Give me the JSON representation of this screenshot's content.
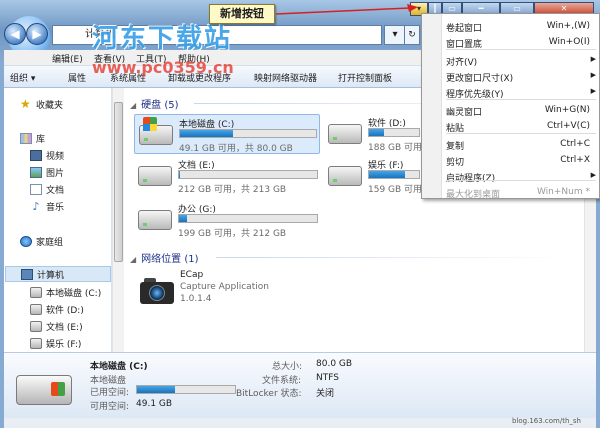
{
  "address": {
    "path": "计算机",
    "arrow": "▾",
    "refresh": "↻"
  },
  "nav_buttons": {
    "back": "◀",
    "forward": "▶"
  },
  "menubar": [
    "编辑(E)",
    "查看(V)",
    "工具(T)",
    "帮助(H)"
  ],
  "toolbar": [
    "组织 ▾",
    "属性",
    "系统属性",
    "卸载或更改程序",
    "映射网络驱动器",
    "打开控制面板"
  ],
  "nav": {
    "favorites": "收藏夹",
    "libraries": "库",
    "lib_items": [
      "视频",
      "图片",
      "文档",
      "音乐"
    ],
    "homegroup": "家庭组",
    "computer": "计算机",
    "drives": [
      "本地磁盘 (C:)",
      "软件 (D:)",
      "文档 (E:)",
      "娱乐 (F:)"
    ]
  },
  "main": {
    "disks_header": "硬盘 (5)",
    "drives": [
      {
        "name": "本地磁盘 (C:)",
        "free": "49.1 GB 可用，共 80.0 GB",
        "used_fraction": 0.39
      },
      {
        "name": "软件 (D:)",
        "free": "188 GB 可用",
        "used_fraction": 0.3
      },
      {
        "name": "文档 (E:)",
        "free": "212 GB 可用，共 213 GB",
        "used_fraction": 0.01
      },
      {
        "name": "娱乐 (F:)",
        "free": "159 GB 可用",
        "used_fraction": 0.72
      },
      {
        "name": "办公 (G:)",
        "free": "199 GB 可用，共 212 GB",
        "used_fraction": 0.06
      }
    ],
    "net_header": "网络位置 (1)",
    "app": {
      "name": "ECap",
      "desc": "Capture Application",
      "version": "1.0.1.4"
    }
  },
  "details": {
    "name": "本地磁盘 (C:)",
    "type": "本地磁盘",
    "used_label": "已用空间:",
    "used_fraction": 0.39,
    "free_label": "可用空间:",
    "free_value": "49.1 GB",
    "total_label": "总大小:",
    "total_value": "80.0 GB",
    "fs_label": "文件系统:",
    "fs_value": "NTFS",
    "bitlocker_label": "BitLocker 状态:",
    "bitlocker_value": "关闭"
  },
  "title_buttons": [
    "▾",
    "┃",
    "▭",
    "━",
    "▭",
    "✕"
  ],
  "callout": "新增按钮",
  "watermark": {
    "title": "河东下载站",
    "url": "www.pc0359.cn"
  },
  "credit": "blog.163.com/th_sh",
  "context_menu": [
    {
      "label": "卷起窗口",
      "shortcut": "Win+,(W)"
    },
    {
      "label": "窗口置底",
      "shortcut": "Win+O(I)"
    },
    {
      "label": "对齐(V)",
      "submenu": true
    },
    {
      "label": "更改窗口尺寸(X)",
      "submenu": true
    },
    {
      "label": "程序优先级(Y)",
      "submenu": true
    },
    {
      "label": "幽灵窗口",
      "shortcut": "Win+G(N)"
    },
    {
      "label": "粘贴",
      "shortcut": "Ctrl+V(C)"
    },
    {
      "label": "复制",
      "shortcut": "Ctrl+C"
    },
    {
      "label": "剪切",
      "shortcut": "Ctrl+X"
    },
    {
      "label": "启动程序(Z)",
      "submenu": true
    },
    {
      "label": "最大化到桌面",
      "shortcut": "Win+Num *",
      "disabled": true
    }
  ]
}
